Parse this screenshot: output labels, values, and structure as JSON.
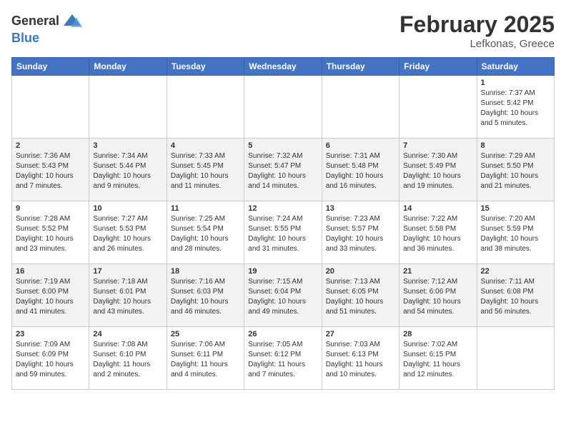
{
  "logo": {
    "general": "General",
    "blue": "Blue"
  },
  "header": {
    "month": "February 2025",
    "location": "Lefkonas, Greece"
  },
  "weekdays": [
    "Sunday",
    "Monday",
    "Tuesday",
    "Wednesday",
    "Thursday",
    "Friday",
    "Saturday"
  ],
  "weeks": [
    [
      {
        "day": "",
        "info": ""
      },
      {
        "day": "",
        "info": ""
      },
      {
        "day": "",
        "info": ""
      },
      {
        "day": "",
        "info": ""
      },
      {
        "day": "",
        "info": ""
      },
      {
        "day": "",
        "info": ""
      },
      {
        "day": "1",
        "info": "Sunrise: 7:37 AM\nSunset: 5:42 PM\nDaylight: 10 hours\nand 5 minutes."
      }
    ],
    [
      {
        "day": "2",
        "info": "Sunrise: 7:36 AM\nSunset: 5:43 PM\nDaylight: 10 hours\nand 7 minutes."
      },
      {
        "day": "3",
        "info": "Sunrise: 7:34 AM\nSunset: 5:44 PM\nDaylight: 10 hours\nand 9 minutes."
      },
      {
        "day": "4",
        "info": "Sunrise: 7:33 AM\nSunset: 5:45 PM\nDaylight: 10 hours\nand 11 minutes."
      },
      {
        "day": "5",
        "info": "Sunrise: 7:32 AM\nSunset: 5:47 PM\nDaylight: 10 hours\nand 14 minutes."
      },
      {
        "day": "6",
        "info": "Sunrise: 7:31 AM\nSunset: 5:48 PM\nDaylight: 10 hours\nand 16 minutes."
      },
      {
        "day": "7",
        "info": "Sunrise: 7:30 AM\nSunset: 5:49 PM\nDaylight: 10 hours\nand 19 minutes."
      },
      {
        "day": "8",
        "info": "Sunrise: 7:29 AM\nSunset: 5:50 PM\nDaylight: 10 hours\nand 21 minutes."
      }
    ],
    [
      {
        "day": "9",
        "info": "Sunrise: 7:28 AM\nSunset: 5:52 PM\nDaylight: 10 hours\nand 23 minutes."
      },
      {
        "day": "10",
        "info": "Sunrise: 7:27 AM\nSunset: 5:53 PM\nDaylight: 10 hours\nand 26 minutes."
      },
      {
        "day": "11",
        "info": "Sunrise: 7:25 AM\nSunset: 5:54 PM\nDaylight: 10 hours\nand 28 minutes."
      },
      {
        "day": "12",
        "info": "Sunrise: 7:24 AM\nSunset: 5:55 PM\nDaylight: 10 hours\nand 31 minutes."
      },
      {
        "day": "13",
        "info": "Sunrise: 7:23 AM\nSunset: 5:57 PM\nDaylight: 10 hours\nand 33 minutes."
      },
      {
        "day": "14",
        "info": "Sunrise: 7:22 AM\nSunset: 5:58 PM\nDaylight: 10 hours\nand 36 minutes."
      },
      {
        "day": "15",
        "info": "Sunrise: 7:20 AM\nSunset: 5:59 PM\nDaylight: 10 hours\nand 38 minutes."
      }
    ],
    [
      {
        "day": "16",
        "info": "Sunrise: 7:19 AM\nSunset: 6:00 PM\nDaylight: 10 hours\nand 41 minutes."
      },
      {
        "day": "17",
        "info": "Sunrise: 7:18 AM\nSunset: 6:01 PM\nDaylight: 10 hours\nand 43 minutes."
      },
      {
        "day": "18",
        "info": "Sunrise: 7:16 AM\nSunset: 6:03 PM\nDaylight: 10 hours\nand 46 minutes."
      },
      {
        "day": "19",
        "info": "Sunrise: 7:15 AM\nSunset: 6:04 PM\nDaylight: 10 hours\nand 49 minutes."
      },
      {
        "day": "20",
        "info": "Sunrise: 7:13 AM\nSunset: 6:05 PM\nDaylight: 10 hours\nand 51 minutes."
      },
      {
        "day": "21",
        "info": "Sunrise: 7:12 AM\nSunset: 6:06 PM\nDaylight: 10 hours\nand 54 minutes."
      },
      {
        "day": "22",
        "info": "Sunrise: 7:11 AM\nSunset: 6:08 PM\nDaylight: 10 hours\nand 56 minutes."
      }
    ],
    [
      {
        "day": "23",
        "info": "Sunrise: 7:09 AM\nSunset: 6:09 PM\nDaylight: 10 hours\nand 59 minutes."
      },
      {
        "day": "24",
        "info": "Sunrise: 7:08 AM\nSunset: 6:10 PM\nDaylight: 11 hours\nand 2 minutes."
      },
      {
        "day": "25",
        "info": "Sunrise: 7:06 AM\nSunset: 6:11 PM\nDaylight: 11 hours\nand 4 minutes."
      },
      {
        "day": "26",
        "info": "Sunrise: 7:05 AM\nSunset: 6:12 PM\nDaylight: 11 hours\nand 7 minutes."
      },
      {
        "day": "27",
        "info": "Sunrise: 7:03 AM\nSunset: 6:13 PM\nDaylight: 11 hours\nand 10 minutes."
      },
      {
        "day": "28",
        "info": "Sunrise: 7:02 AM\nSunset: 6:15 PM\nDaylight: 11 hours\nand 12 minutes."
      },
      {
        "day": "",
        "info": ""
      }
    ]
  ]
}
